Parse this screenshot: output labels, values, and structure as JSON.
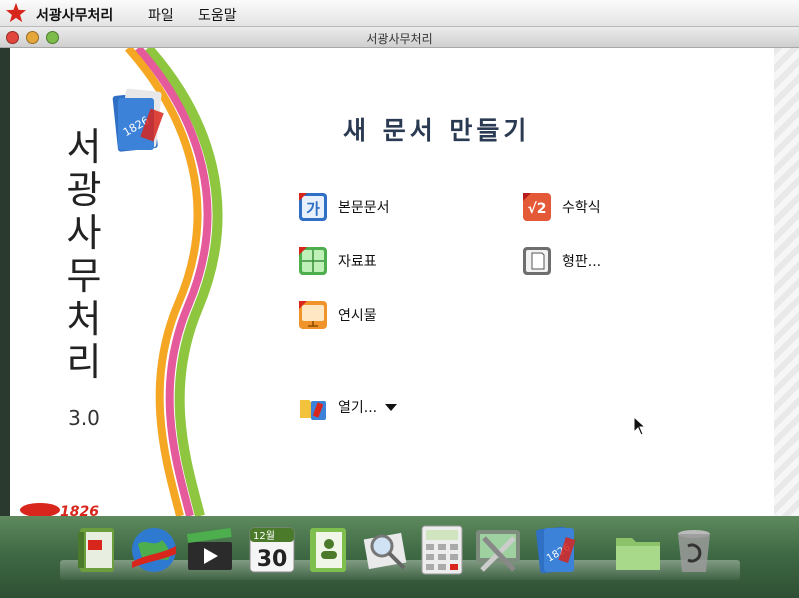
{
  "menubar": {
    "app_name": "서광사무처리",
    "items": [
      "파일",
      "도움말"
    ]
  },
  "window": {
    "title": "서광사무처리"
  },
  "brand": {
    "name_vertical": [
      "서",
      "광",
      "사",
      "무",
      "처",
      "리"
    ],
    "version": "3.0"
  },
  "main": {
    "heading": "새 문서 만들기",
    "options": {
      "text_doc": "본문문서",
      "math": "수학식",
      "spreadsheet": "자료표",
      "template": "형판...",
      "presentation": "연시물",
      "open": "열기..."
    }
  },
  "dock": {
    "icons": [
      "address-book-icon",
      "globe-browser-icon",
      "video-clapper-icon",
      "calendar-icon",
      "contacts-book-icon",
      "image-viewer-icon",
      "calculator-icon",
      "settings-tools-icon",
      "office-suite-icon",
      "folder-icon",
      "trash-icon"
    ],
    "calendar_month": "12월",
    "calendar_day": "30"
  },
  "colors": {
    "heading": "#2a3a52",
    "dock": "#3f6a44",
    "accent_red": "#d8261c"
  }
}
